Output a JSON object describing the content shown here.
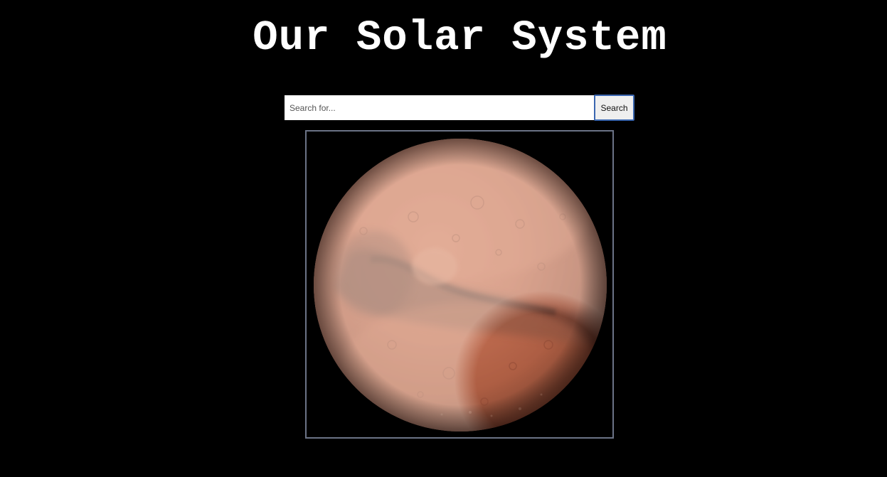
{
  "header": {
    "title": "Our Solar System"
  },
  "search": {
    "placeholder": "Search for...",
    "value": "",
    "button_label": "Search"
  },
  "planet_image": {
    "subject": "mars-image",
    "alt": "Mars"
  },
  "colors": {
    "background": "#000000",
    "title": "#ffffff",
    "frame_border": "#6b7386",
    "button_focus_border": "#3a66b0",
    "planet_base": "#b8644a"
  }
}
